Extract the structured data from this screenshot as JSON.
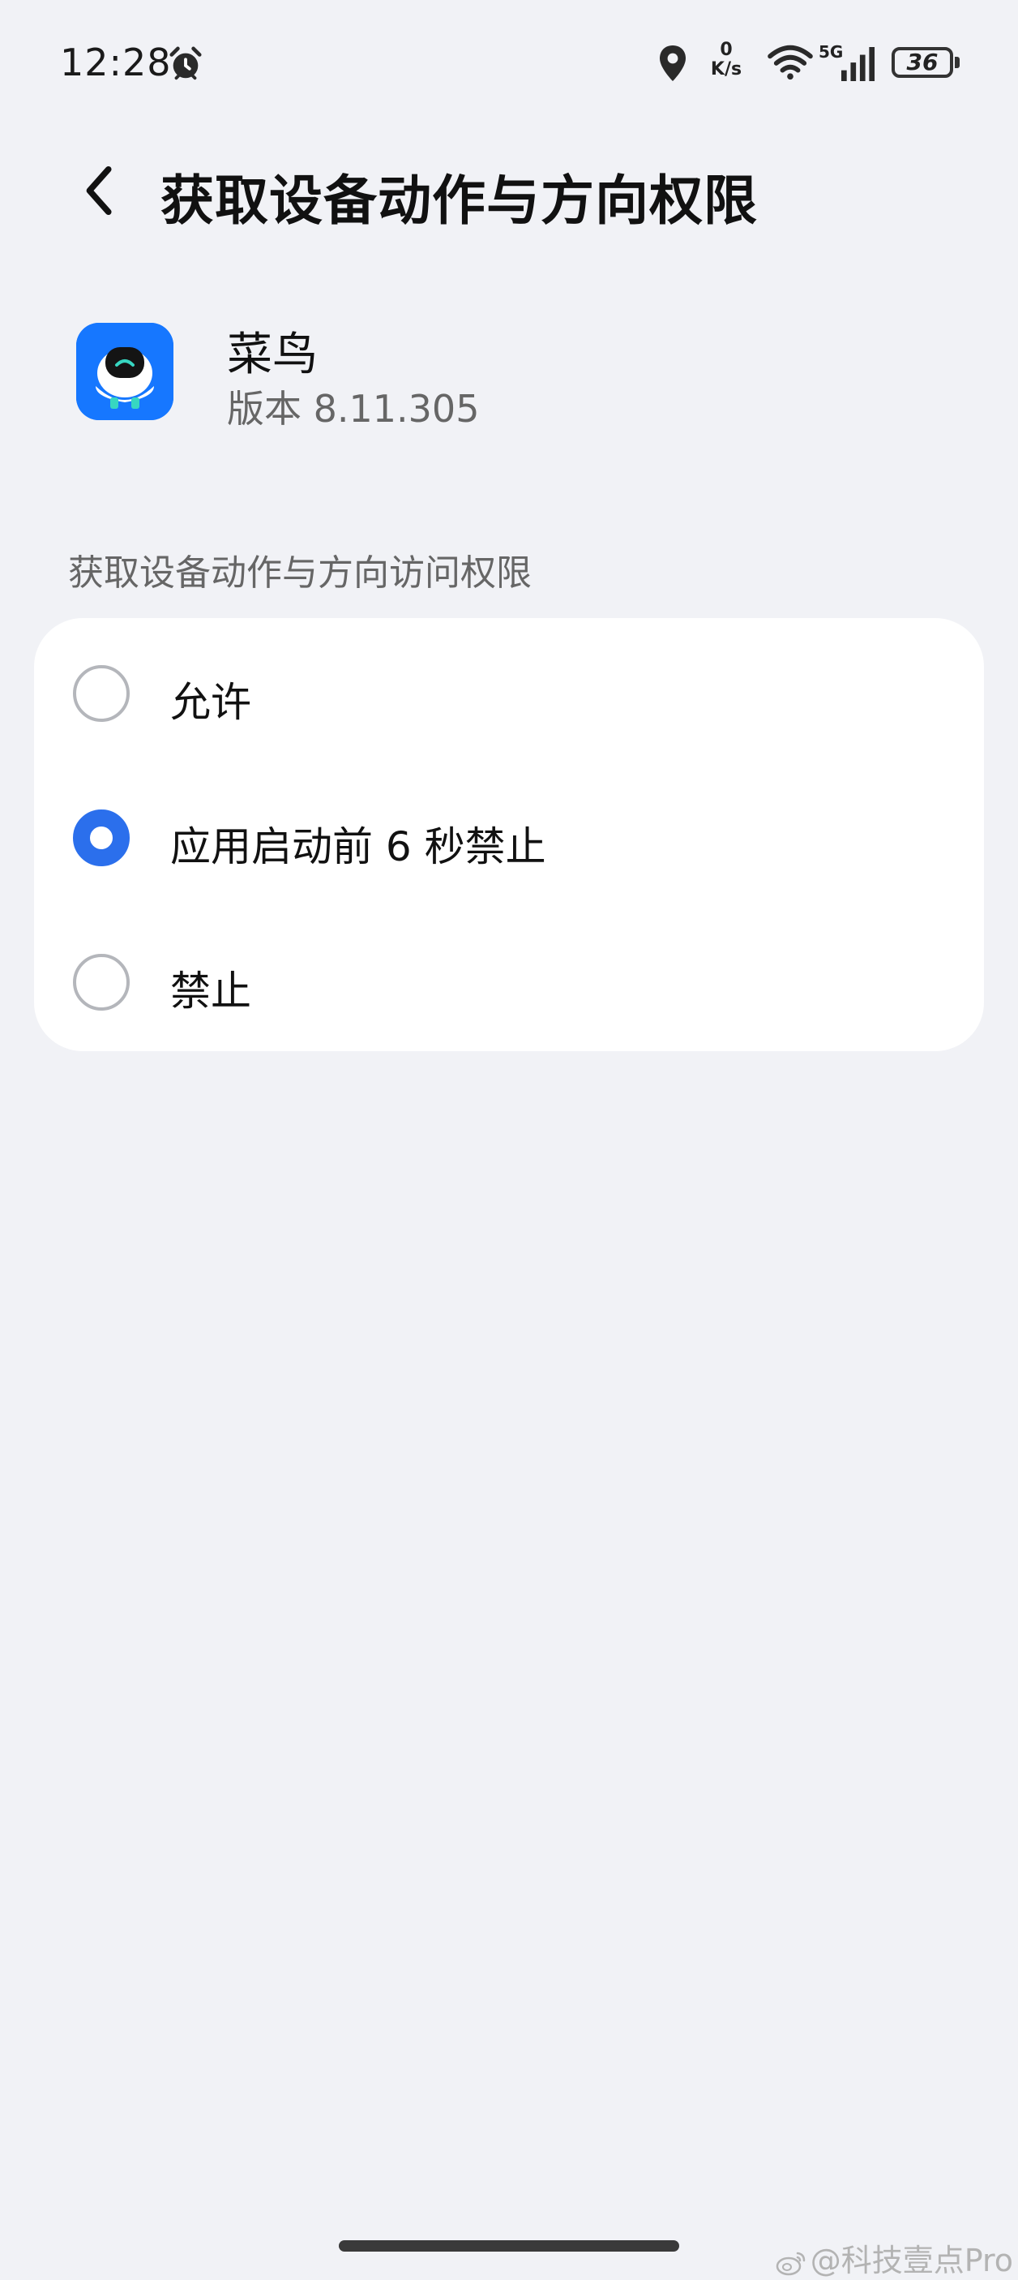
{
  "status_bar": {
    "time": "12:28",
    "net_speed_value": "0",
    "net_speed_unit": "K/s",
    "signal_label": "5G",
    "battery": "36",
    "icons": [
      "alarm-icon",
      "location-icon",
      "wifi-icon",
      "signal-icon",
      "battery-icon"
    ]
  },
  "header": {
    "title": "获取设备动作与方向权限",
    "back_icon": "chevron-left-icon"
  },
  "app": {
    "name": "菜鸟",
    "version": "版本 8.11.305",
    "icon": "cainiao-app-icon"
  },
  "section": {
    "label": "获取设备动作与方向访问权限"
  },
  "options": [
    {
      "label": "允许",
      "selected": false
    },
    {
      "label": "应用启动前 6 秒禁止",
      "selected": true
    },
    {
      "label": "禁止",
      "selected": false
    }
  ],
  "colors": {
    "background": "#f1f2f6",
    "card": "#ffffff",
    "accent": "#2b6fec",
    "app_icon_bg": "#1677ff"
  },
  "watermark": "@科技壹点Pro"
}
